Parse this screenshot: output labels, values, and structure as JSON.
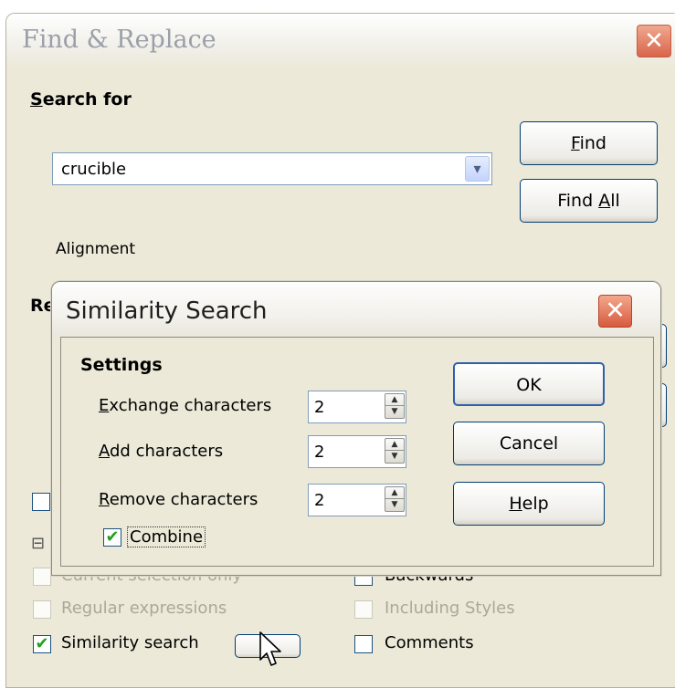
{
  "find_replace": {
    "title": "Find & Replace",
    "close_glyph": "✕",
    "search_for_label": "Search for",
    "search_value": "crucible",
    "find_button": "Find",
    "find_all_button": "Find All",
    "alignment_label": "Alignment",
    "replace_label_partial": "Re",
    "options": {
      "current_selection_only": "Current selection only",
      "regular_expressions": "Regular expressions",
      "similarity_search": "Similarity search",
      "backwards": "Backwards",
      "including_styles": "Including Styles",
      "comments": "Comments",
      "similarity_search_checked": true,
      "backwards_checked": false,
      "comments_checked": false
    }
  },
  "similarity_dialog": {
    "title": "Similarity Search",
    "close_glyph": "✕",
    "settings_heading": "Settings",
    "exchange_label": "Exchange characters",
    "exchange_value": "2",
    "add_label": "Add characters",
    "add_value": "2",
    "remove_label": "Remove characters",
    "remove_value": "2",
    "combine_label": "Combine",
    "combine_checked": true,
    "ok_button": "OK",
    "cancel_button": "Cancel",
    "help_button": "Help"
  },
  "icons": {
    "check_glyph": "✔",
    "dropdown_glyph": "▾",
    "spin_up_glyph": "▲",
    "spin_down_glyph": "▼",
    "collapse_glyph": "⊟"
  }
}
